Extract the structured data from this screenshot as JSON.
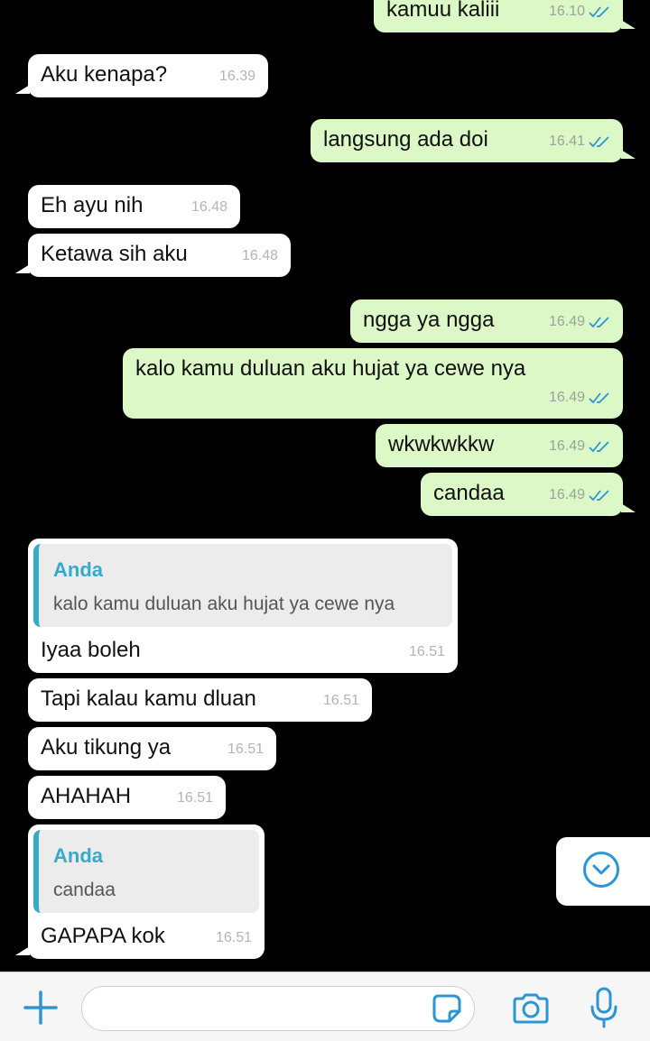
{
  "messages": [
    {
      "type": "out",
      "text": "kamuu kaliii",
      "time": "16.10",
      "ticks": true
    },
    {
      "type": "in",
      "text": "Aku kenapa?",
      "time": "16.39"
    },
    {
      "type": "out",
      "text": "langsung ada doi",
      "time": "16.41",
      "ticks": true
    },
    {
      "type": "in",
      "text": "Eh ayu nih",
      "time": "16.48"
    },
    {
      "type": "in",
      "text": "Ketawa sih aku",
      "time": "16.48"
    },
    {
      "type": "out",
      "text": "ngga ya ngga",
      "time": "16.49",
      "ticks": true
    },
    {
      "type": "out",
      "text": "kalo kamu duluan aku hujat ya cewe nya",
      "time": "16.49",
      "ticks": true
    },
    {
      "type": "out",
      "text": "wkwkwkkw",
      "time": "16.49",
      "ticks": true
    },
    {
      "type": "out",
      "text": "candaa",
      "time": "16.49",
      "ticks": true
    },
    {
      "type": "in",
      "quote_name": "Anda",
      "quote_text": "kalo kamu duluan aku hujat ya cewe nya",
      "text": "Iyaa boleh",
      "time": "16.51"
    },
    {
      "type": "in",
      "text": "Tapi kalau kamu dluan",
      "time": "16.51"
    },
    {
      "type": "in",
      "text": "Aku tikung ya",
      "time": "16.51"
    },
    {
      "type": "in",
      "text": "AHAHAH",
      "time": "16.51"
    },
    {
      "type": "in",
      "quote_name": "Anda",
      "quote_text": "candaa",
      "text": "GAPAPA kok",
      "time": "16.51"
    }
  ],
  "colors": {
    "background": "#000000",
    "incoming_bubble": "#ffffff",
    "outgoing_bubble": "#dcf8c6",
    "accent": "#2b95d6",
    "quote_accent": "#35aac9"
  },
  "composer": {
    "placeholder": "",
    "icons": [
      "plus-icon",
      "sticker-icon",
      "camera-icon",
      "microphone-icon"
    ]
  },
  "scroll_button": {
    "icon": "chevron-down-icon"
  }
}
